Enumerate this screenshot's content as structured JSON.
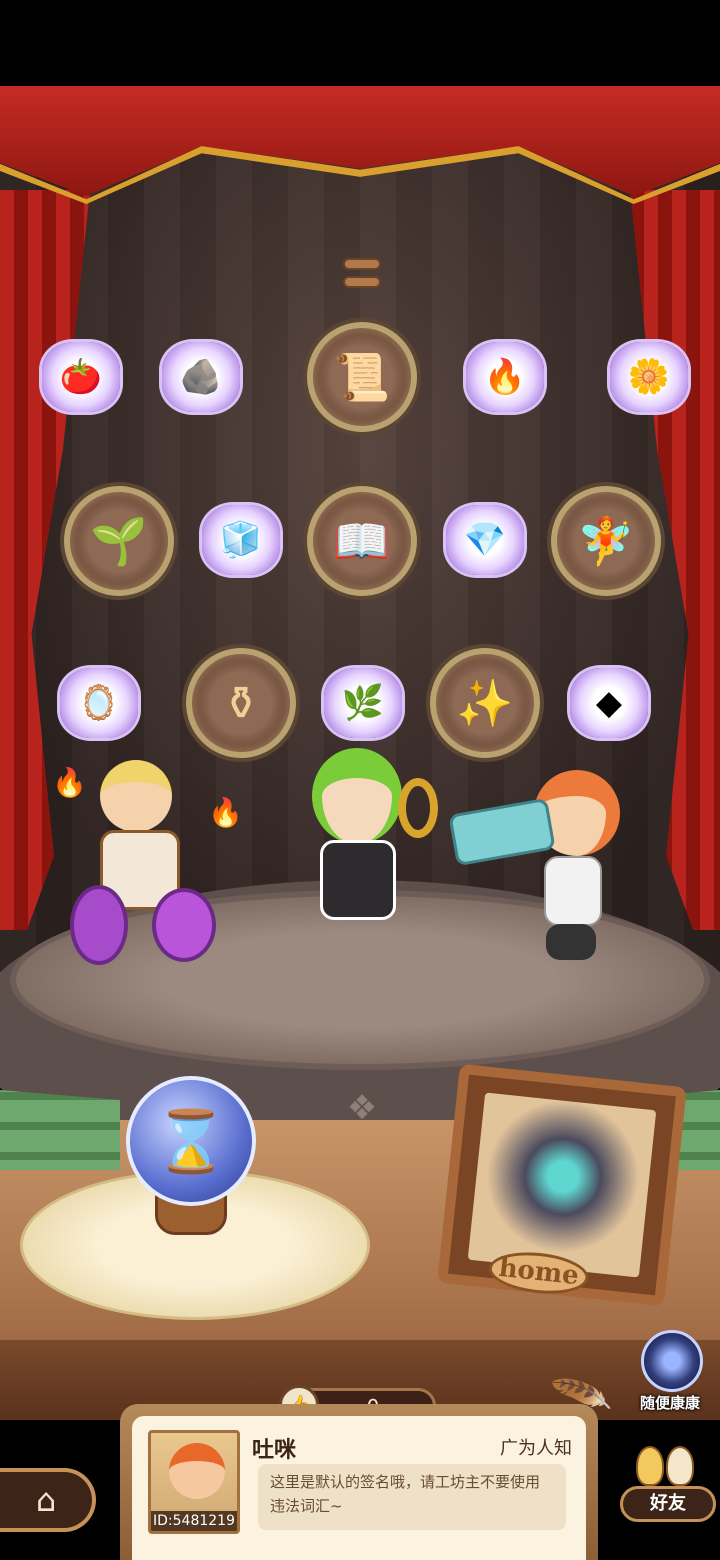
{
  "collection": {
    "row1": [
      {
        "name": "tomato-icon",
        "glyph": "🍅",
        "type": "small"
      },
      {
        "name": "ore-pile-icon",
        "glyph": "🪨",
        "type": "small"
      },
      {
        "name": "quest-scroll-icon",
        "glyph": "📜",
        "type": "big"
      },
      {
        "name": "lava-stone-icon",
        "glyph": "🔥",
        "type": "small"
      },
      {
        "name": "gold-flower-icon",
        "glyph": "🌼",
        "type": "small"
      }
    ],
    "row2": [
      {
        "name": "plant-hand-icon",
        "glyph": "🌱",
        "type": "big"
      },
      {
        "name": "ice-crystal-icon",
        "glyph": "🧊",
        "type": "small"
      },
      {
        "name": "book-icon",
        "glyph": "📖",
        "type": "big"
      },
      {
        "name": "diamond-icon",
        "glyph": "💎",
        "type": "small"
      },
      {
        "name": "fairy-icon",
        "glyph": "🧚",
        "type": "big"
      }
    ],
    "row3": [
      {
        "name": "mirror-icon",
        "glyph": "🪞",
        "type": "small"
      },
      {
        "name": "cauldron-icon",
        "glyph": "⚱",
        "type": "big"
      },
      {
        "name": "herb-icon",
        "glyph": "🌿",
        "type": "small"
      },
      {
        "name": "sparkle-sprout-icon",
        "glyph": "✨",
        "type": "big"
      },
      {
        "name": "dark-stone-icon",
        "glyph": "◆",
        "type": "small"
      }
    ]
  },
  "home_frame": {
    "label": "home"
  },
  "likes": {
    "count": "0"
  },
  "profile": {
    "nickname": "吐咪",
    "fame": "广为人知",
    "id": "ID:5481219",
    "signature": "这里是默认的签名哦，请工坊主不要使用违法词汇~"
  },
  "buttons": {
    "random": "随便康康",
    "friends": "好友",
    "home_icon": "⌂"
  },
  "colors": {
    "curtain": "#c62b24",
    "fringe": "#d9a02d",
    "wall": "#4a3a37"
  }
}
